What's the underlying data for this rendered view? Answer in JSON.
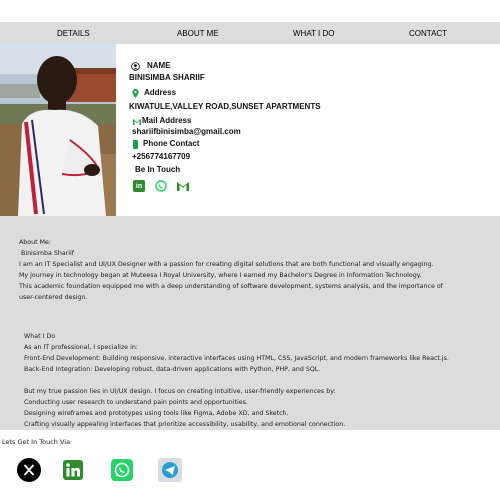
{
  "nav": {
    "items": [
      "DETAILS",
      "ABOUT ME",
      "WHAT I DO",
      "CONTACT"
    ]
  },
  "profile": {
    "name_label": "NAME",
    "name": "BINISIMBA SHARIIF",
    "address_label": "Address",
    "address": "KIWATULE,VALLEY ROAD,SUNSET APARTMENTS",
    "mail_label": "Mail Address",
    "email": "shariifbinisimba@gmail.com",
    "phone_label": "Phone Contact",
    "phone": "+256774167709",
    "touch_label": "Be In Touch"
  },
  "about": {
    "heading": "About Me:",
    "name": "Binisimba Shariif",
    "lines": [
      "I am an IT Specialist and UI/UX Designer with a passion for creating digital solutions that are both functional and visually engaging.",
      "My journey in technology began at Muteesa I Royal University, where I earned my Bachelor's Degree in Information Technology.",
      "This academic foundation equipped me with a deep understanding of software development, systems analysis, and the importance of",
      "user-centered design."
    ]
  },
  "whatido": {
    "heading": "What I Do",
    "intro": "As an IT professional, I specialize in:",
    "lines1": [
      "Front-End Development: Building responsive, interactive interfaces using HTML, CSS, JavaScript, and modern frameworks like React.js.",
      "Back-End Integration: Developing robust, data-driven applications with Python, PHP, and SQL."
    ],
    "lines2": [
      "But my true passion lies in UI/UX design. I focus on creating intuitive, user-friendly experiences by:",
      "Conducting user research to understand pain points and opportunities.",
      "Designing wireframes and prototypes using tools like Figma, Adobe XD, and Sketch.",
      "Crafting visually appealing interfaces that prioritize accessibility, usability, and emotional connection."
    ]
  },
  "contact": {
    "label": "Lets Get In Touch Via",
    "icons": [
      "x-icon",
      "linkedin-icon",
      "whatsapp-icon",
      "telegram-icon"
    ]
  },
  "colors": {
    "green": "#1aa34a",
    "linkedin_green": "#2e8b2e",
    "whatsapp": "#25d366",
    "grey_bg": "#dcdcdc"
  }
}
